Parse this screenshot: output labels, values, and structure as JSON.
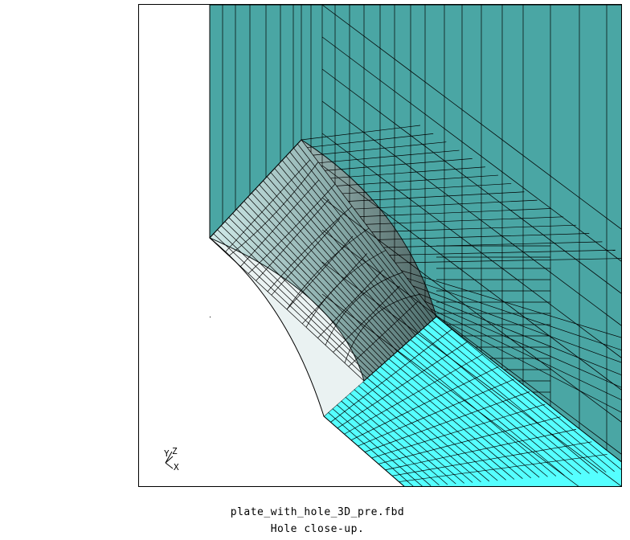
{
  "viewport": {
    "filename": "plate_with_hole_3D_pre.fbd",
    "subtitle": "Hole close-up."
  },
  "triad": {
    "y_label": "Y",
    "z_label": "Z",
    "x_label": "X"
  },
  "colors": {
    "side_face": "#4aa6a4",
    "top_face": "#55ffff",
    "hole_face_light": "#c9d9d8",
    "hole_face_dark": "#5a6b6a",
    "mesh_line": "#000000",
    "background": "#ffffff"
  }
}
